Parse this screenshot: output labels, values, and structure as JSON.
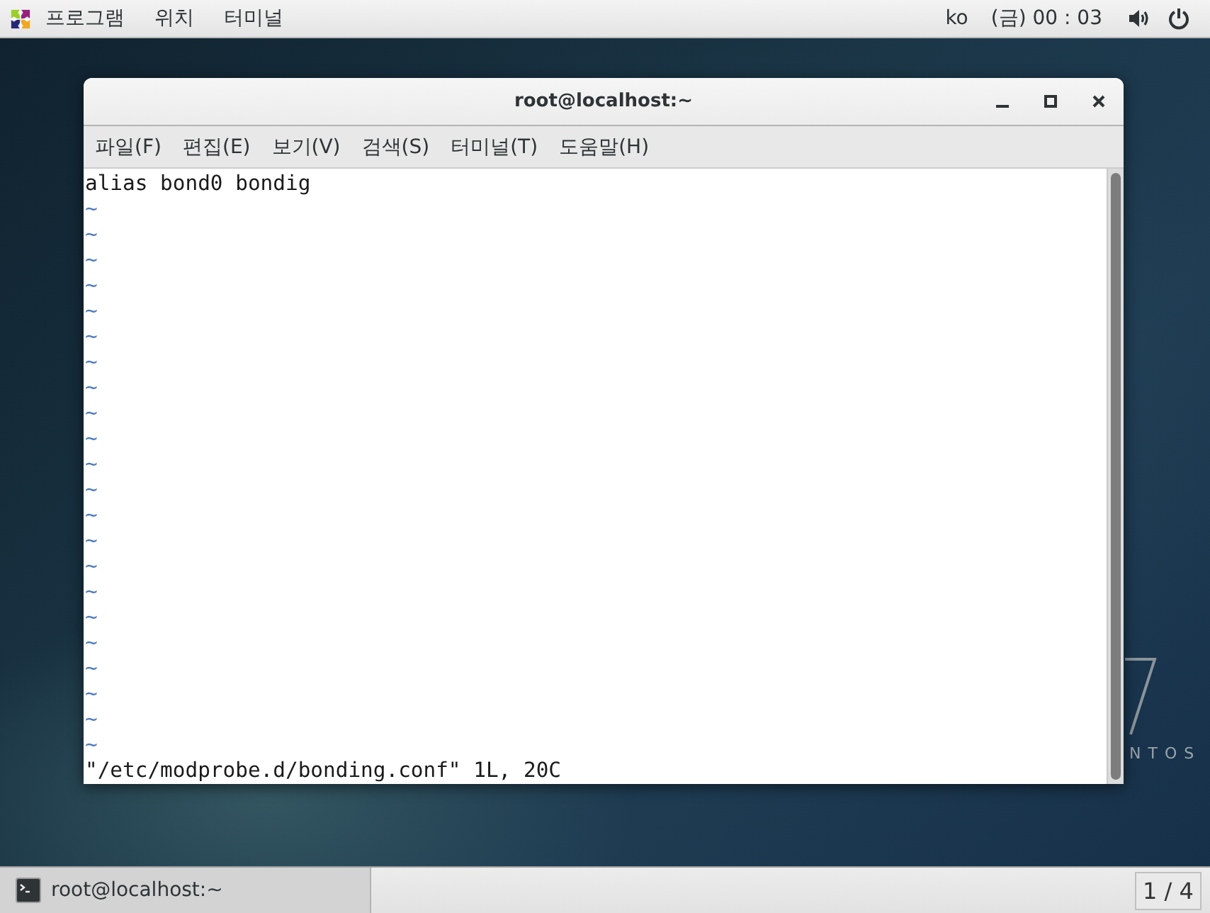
{
  "top_bar": {
    "menus": [
      "프로그램",
      "위치",
      "터미널"
    ],
    "keyboard": "ko",
    "clock": "(금) 00 : 03"
  },
  "wallpaper": {
    "logo_text": "NTOS"
  },
  "window": {
    "title": "root@localhost:~",
    "menu": [
      "파일(F)",
      "편집(E)",
      "보기(V)",
      "검색(S)",
      "터미널(T)",
      "도움말(H)"
    ],
    "lines": [
      {
        "kind": "text",
        "text": "alias bond0 bondig"
      },
      {
        "kind": "tilde",
        "text": "~"
      },
      {
        "kind": "tilde",
        "text": "~"
      },
      {
        "kind": "tilde",
        "text": "~"
      },
      {
        "kind": "tilde",
        "text": "~"
      },
      {
        "kind": "tilde",
        "text": "~"
      },
      {
        "kind": "tilde",
        "text": "~"
      },
      {
        "kind": "tilde",
        "text": "~"
      },
      {
        "kind": "tilde",
        "text": "~"
      },
      {
        "kind": "tilde",
        "text": "~"
      },
      {
        "kind": "tilde",
        "text": "~"
      },
      {
        "kind": "tilde",
        "text": "~"
      },
      {
        "kind": "tilde",
        "text": "~"
      },
      {
        "kind": "tilde",
        "text": "~"
      },
      {
        "kind": "tilde",
        "text": "~"
      },
      {
        "kind": "tilde",
        "text": "~"
      },
      {
        "kind": "tilde",
        "text": "~"
      },
      {
        "kind": "tilde",
        "text": "~"
      },
      {
        "kind": "tilde",
        "text": "~"
      },
      {
        "kind": "tilde",
        "text": "~"
      },
      {
        "kind": "tilde",
        "text": "~"
      },
      {
        "kind": "tilde",
        "text": "~"
      },
      {
        "kind": "tilde",
        "text": "~"
      }
    ],
    "status_line": "\"/etc/modprobe.d/bonding.conf\" 1L, 20C"
  },
  "taskbar": {
    "tasks": [
      {
        "label": "root@localhost:~",
        "selected": true
      }
    ],
    "workspace": "1 / 4"
  }
}
